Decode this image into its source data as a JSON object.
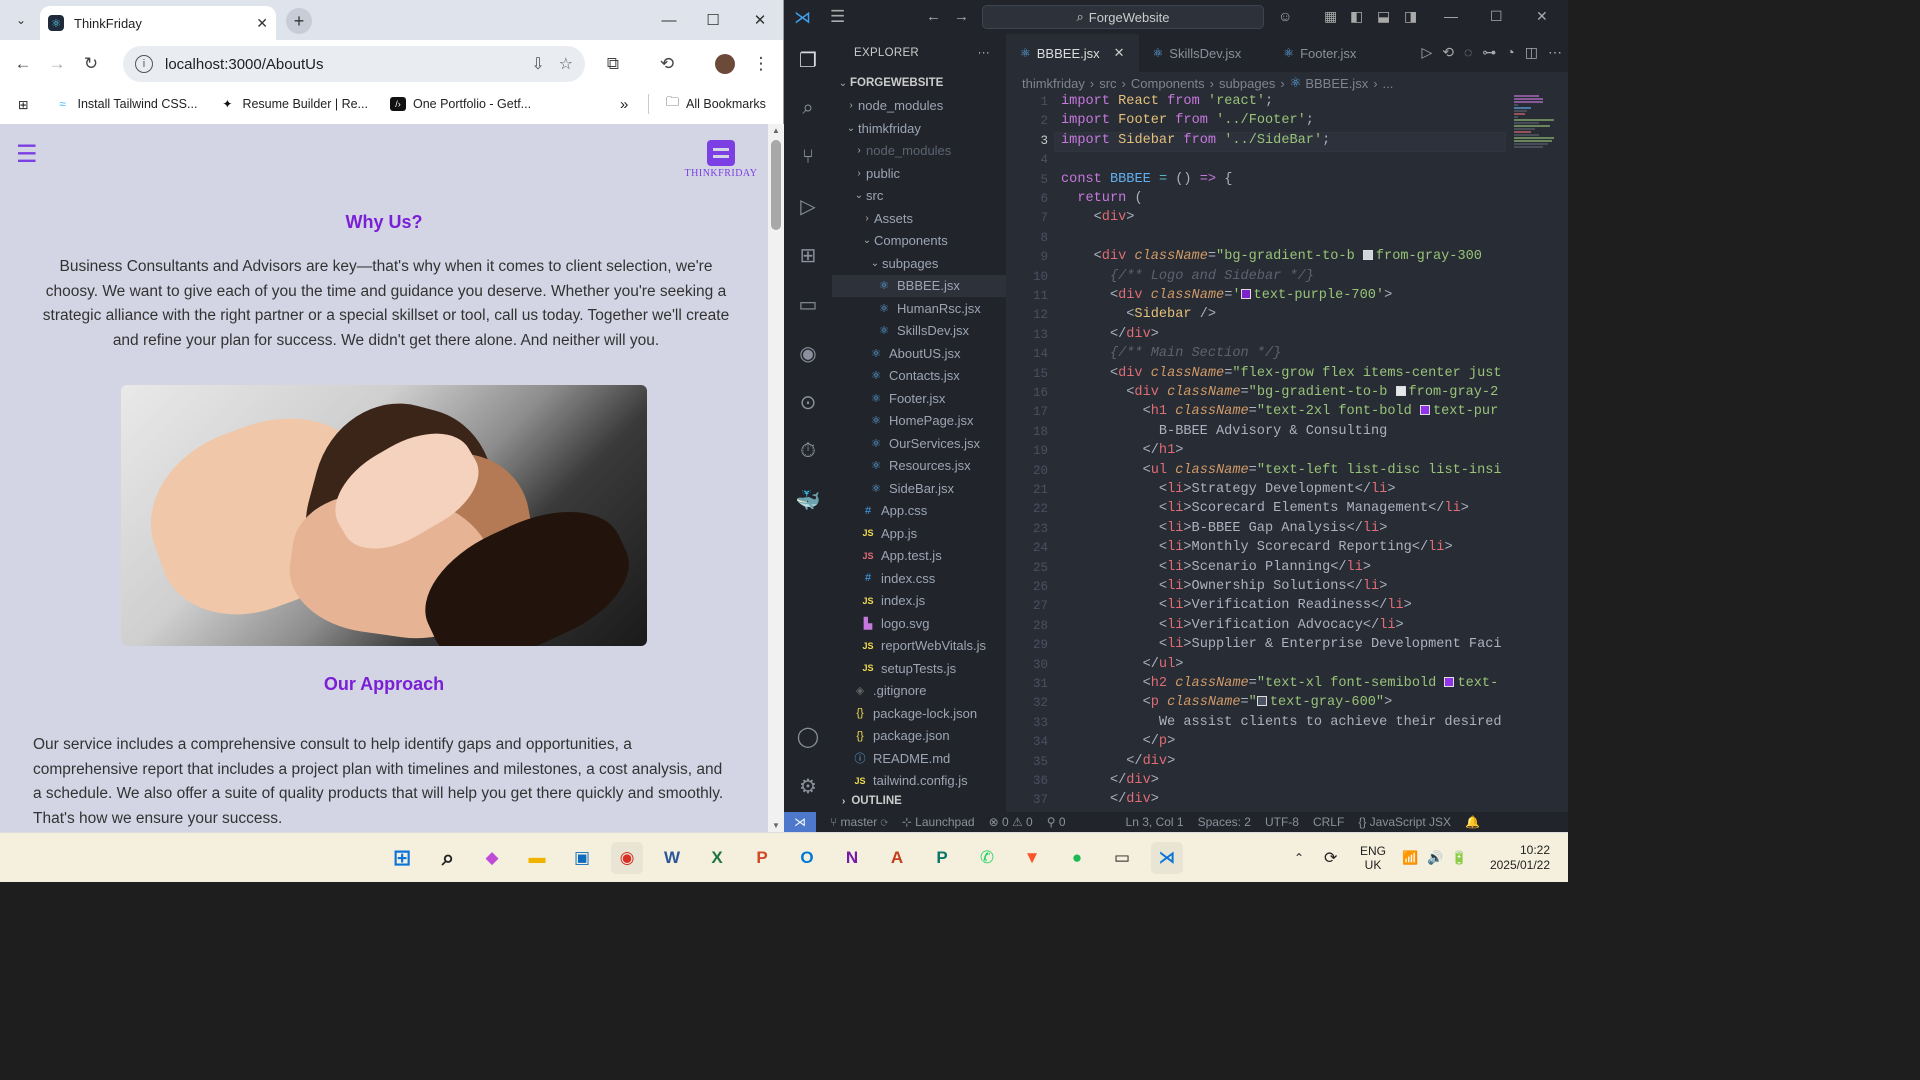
{
  "chrome": {
    "tab_title": "ThinkFriday",
    "url": "localhost:3000/AboutUs",
    "bookmarks": [
      {
        "label": "Install Tailwind CSS...",
        "icon": "tailwind-icon"
      },
      {
        "label": "Resume Builder | Re...",
        "icon": "resume-icon"
      },
      {
        "label": "One Portfolio - Getf...",
        "icon": "portfolio-icon"
      }
    ],
    "more_bookmarks": "»",
    "all_bookmarks": "All Bookmarks",
    "page": {
      "logo_text": "THINKFRIDAY",
      "why_heading": "Why Us?",
      "why_text": "Business Consultants and Advisors are key—that's why when it comes to client selection, we're choosy. We want to give each of you the time and guidance you deserve. Whether you're seeking a strategic alliance with the right partner or a special skillset or tool, call us today. Together we'll create and refine your plan for success. We didn't get there alone. And neither will you.",
      "approach_heading": "Our Approach",
      "approach_text": "Our service includes a comprehensive consult to help identify gaps and opportunities, a comprehensive report that includes a project plan with timelines and milestones, a cost analysis, and a schedule. We also offer a suite of quality products that will help you get there quickly and smoothly. That's how we ensure your success."
    }
  },
  "vscode": {
    "search": "ForgeWebsite",
    "explorer_title": "EXPLORER",
    "explorer_more": "···",
    "tabs": [
      "BBBEE.jsx",
      "SkillsDev.jsx",
      "Footer.jsx"
    ],
    "breadcrumb": [
      "thimkfriday",
      "src",
      "Components",
      "subpages",
      "BBBEE.jsx",
      "..."
    ],
    "tree": [
      {
        "label": "FORGEWEBSITE",
        "indent": 0,
        "chev": "⌄",
        "bold": true
      },
      {
        "label": "node_modules",
        "indent": 1,
        "chev": "›"
      },
      {
        "label": "thimkfriday",
        "indent": 1,
        "chev": "⌄"
      },
      {
        "label": "node_modules",
        "indent": 2,
        "chev": "›",
        "dim": true
      },
      {
        "label": "public",
        "indent": 2,
        "chev": "›"
      },
      {
        "label": "src",
        "indent": 2,
        "chev": "⌄"
      },
      {
        "label": "Assets",
        "indent": 3,
        "chev": "›"
      },
      {
        "label": "Components",
        "indent": 3,
        "chev": "⌄"
      },
      {
        "label": "subpages",
        "indent": 4,
        "chev": "⌄"
      },
      {
        "label": "BBBEE.jsx",
        "indent": 5,
        "icon": "react",
        "sel": true
      },
      {
        "label": "HumanRsc.jsx",
        "indent": 5,
        "icon": "react"
      },
      {
        "label": "SkillsDev.jsx",
        "indent": 5,
        "icon": "react"
      },
      {
        "label": "AboutUS.jsx",
        "indent": 4,
        "icon": "react"
      },
      {
        "label": "Contacts.jsx",
        "indent": 4,
        "icon": "react"
      },
      {
        "label": "Footer.jsx",
        "indent": 4,
        "icon": "react"
      },
      {
        "label": "HomePage.jsx",
        "indent": 4,
        "icon": "react"
      },
      {
        "label": "OurServices.jsx",
        "indent": 4,
        "icon": "react"
      },
      {
        "label": "Resources.jsx",
        "indent": 4,
        "icon": "react"
      },
      {
        "label": "SideBar.jsx",
        "indent": 4,
        "icon": "react"
      },
      {
        "label": "App.css",
        "indent": 3,
        "icon": "css"
      },
      {
        "label": "App.js",
        "indent": 3,
        "icon": "js"
      },
      {
        "label": "App.test.js",
        "indent": 3,
        "icon": "jsr"
      },
      {
        "label": "index.css",
        "indent": 3,
        "icon": "css"
      },
      {
        "label": "index.js",
        "indent": 3,
        "icon": "js"
      },
      {
        "label": "logo.svg",
        "indent": 3,
        "icon": "svg"
      },
      {
        "label": "reportWebVitals.js",
        "indent": 3,
        "icon": "js"
      },
      {
        "label": "setupTests.js",
        "indent": 3,
        "icon": "js"
      },
      {
        "label": ".gitignore",
        "indent": 2,
        "icon": "git"
      },
      {
        "label": "package-lock.json",
        "indent": 2,
        "icon": "json"
      },
      {
        "label": "package.json",
        "indent": 2,
        "icon": "json"
      },
      {
        "label": "README.md",
        "indent": 2,
        "icon": "info"
      },
      {
        "label": "tailwind.config.js",
        "indent": 2,
        "icon": "js"
      }
    ],
    "outline": "OUTLINE",
    "current_line": 3,
    "status": {
      "branch": "master",
      "launchpad": "Launchpad",
      "problems": "⊗ 0 ⚠ 0",
      "ports": "0",
      "position": "Ln 3, Col 1",
      "spaces": "Spaces: 2",
      "encoding": "UTF-8",
      "eol": "CRLF",
      "language": "{} JavaScript JSX"
    },
    "code_lines": [
      "<span class=\"k\">import</span> <span class=\"v\">React</span> <span class=\"k\">from</span> <span class=\"s\">'react'</span>;",
      "<span class=\"k\">import</span> <span class=\"v\">Footer</span> <span class=\"k\">from</span> <span class=\"s\">'../Footer'</span>;",
      "<span class=\"k\">import</span> <span class=\"v\">Sidebar</span> <span class=\"k\">from</span> <span class=\"s\">'../SideBar'</span>;",
      "",
      "<span class=\"k\">const</span> <span class=\"f\">BBBEE</span> <span class=\"o\">=</span> () <span class=\"k\">=&gt;</span> {",
      "  <span class=\"k\">return</span> (",
      "    &lt;<span class=\"t\">div</span>&gt;",
      "",
      "    &lt;<span class=\"t\">div</span> <span class=\"a\">className</span>=<span class=\"s\">\"bg-gradient-to-b <span class=\"sw\" style=\"background:#d1d5db\"></span>from-gray-300</span>",
      "      <span class=\"c\">{/** Logo and Sidebar */}</span>",
      "      &lt;<span class=\"t\">div</span> <span class=\"a\">className</span>=<span class=\"s\">'<span class=\"sw\" style=\"background:#7e22ce\"></span>text-purple-700'</span>&gt;",
      "        &lt;<span class=\"v\">Sidebar</span> /&gt;",
      "      &lt;/<span class=\"t\">div</span>&gt;",
      "      <span class=\"c\">{/** Main Section */}</span>",
      "      &lt;<span class=\"t\">div</span> <span class=\"a\">className</span>=<span class=\"s\">\"flex-grow flex items-center just</span>",
      "        &lt;<span class=\"t\">div</span> <span class=\"a\">className</span>=<span class=\"s\">\"bg-gradient-to-b <span class=\"sw\" style=\"background:#e5e7eb\"></span>from-gray-2</span>",
      "          &lt;<span class=\"t\">h1</span> <span class=\"a\">className</span>=<span class=\"s\">\"text-2xl font-bold <span class=\"sw\" style=\"background:#9333ea\"></span>text-pur</span>",
      "            B-BBEE Advisory &amp; Consulting",
      "          &lt;/<span class=\"t\">h1</span>&gt;",
      "          &lt;<span class=\"t\">ul</span> <span class=\"a\">className</span>=<span class=\"s\">\"text-left list-disc list-insi</span>",
      "            &lt;<span class=\"t\">li</span>&gt;Strategy Development&lt;/<span class=\"t\">li</span>&gt;",
      "            &lt;<span class=\"t\">li</span>&gt;Scorecard Elements Management&lt;/<span class=\"t\">li</span>&gt;",
      "            &lt;<span class=\"t\">li</span>&gt;B-BBEE Gap Analysis&lt;/<span class=\"t\">li</span>&gt;",
      "            &lt;<span class=\"t\">li</span>&gt;Monthly Scorecard Reporting&lt;/<span class=\"t\">li</span>&gt;",
      "            &lt;<span class=\"t\">li</span>&gt;Scenario Planning&lt;/<span class=\"t\">li</span>&gt;",
      "            &lt;<span class=\"t\">li</span>&gt;Ownership Solutions&lt;/<span class=\"t\">li</span>&gt;",
      "            &lt;<span class=\"t\">li</span>&gt;Verification Readiness&lt;/<span class=\"t\">li</span>&gt;",
      "            &lt;<span class=\"t\">li</span>&gt;Verification Advocacy&lt;/<span class=\"t\">li</span>&gt;",
      "            &lt;<span class=\"t\">li</span>&gt;Supplier &amp; Enterprise Development Faci",
      "          &lt;/<span class=\"t\">ul</span>&gt;",
      "          &lt;<span class=\"t\">h2</span> <span class=\"a\">className</span>=<span class=\"s\">\"text-xl font-semibold <span class=\"sw\" style=\"background:#9333ea\"></span>text-</span>",
      "          &lt;<span class=\"t\">p</span> <span class=\"a\">className</span>=<span class=\"s\">\"<span class=\"sw\" style=\"background:#4b5563\"></span>text-gray-600\"</span>&gt;",
      "            We assist clients to achieve their desired",
      "          &lt;/<span class=\"t\">p</span>&gt;",
      "        &lt;/<span class=\"t\">div</span>&gt;",
      "      &lt;/<span class=\"t\">div</span>&gt;",
      "      &lt;/<span class=\"t\">div</span>&gt;"
    ]
  },
  "taskbar": {
    "lang_top": "ENG",
    "lang_bottom": "UK",
    "time": "10:22",
    "date": "2025/01/22"
  },
  "colors": {
    "accent_purple": "#7b1fd6",
    "vscode_bg": "#282c34",
    "taskbar_bg": "#f4f0dd"
  }
}
